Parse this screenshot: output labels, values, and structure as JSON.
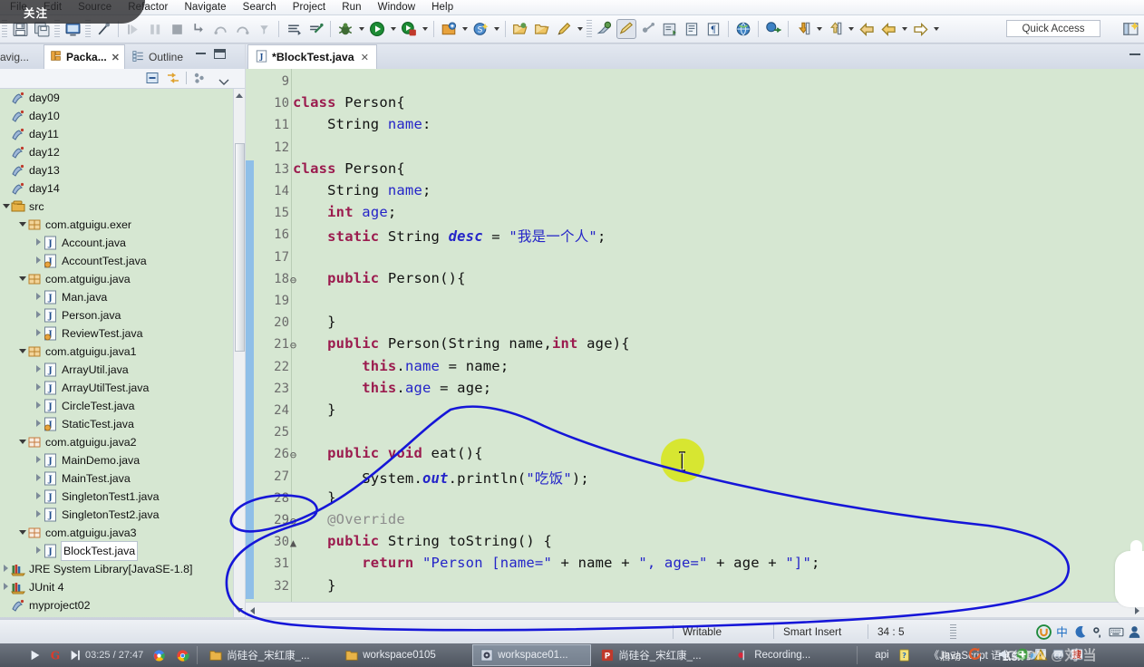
{
  "window": {
    "overlay_badge": "关注"
  },
  "menu": {
    "items": [
      "File",
      "Edit",
      "Source",
      "Refactor",
      "Navigate",
      "Search",
      "Project",
      "Run",
      "Window",
      "Help"
    ]
  },
  "toolbar": {
    "quick_access": "Quick Access",
    "icons": [
      "save-icon",
      "save-all-icon",
      "console-icon",
      "link-icon",
      "run-last-icon",
      "pause-icon",
      "stop-icon",
      "step-into-icon",
      "step-over-icon",
      "step-return-icon",
      "step-filter-icon",
      "skip-breakpoints-icon",
      "debug-toggle-icon",
      "debug-icon",
      "run-icon",
      "coverage-icon",
      "new-java-project-icon",
      "new-scout-icon",
      "open-type-icon",
      "open-task-icon",
      "edit-icon",
      "search-icon",
      "import-icon",
      "export-icon",
      "word-wrap-icon",
      "external-tools-icon",
      "remote-icon",
      "download-icon",
      "upload-icon",
      "back-icon",
      "forward-icon",
      "next-icon"
    ]
  },
  "left_panel": {
    "tabs": [
      {
        "label": "avig...",
        "active": false,
        "closable": false
      },
      {
        "label": "Packa...",
        "active": true,
        "closable": true
      },
      {
        "label": "Outline",
        "active": false,
        "closable": false
      }
    ],
    "view_buttons": [
      "collapse-all-icon",
      "link-with-editor-icon",
      "view-menu-icon",
      "view-dropdown-icon"
    ],
    "tree": [
      {
        "label": "day09",
        "indent": 0,
        "icon": "java-project-icon",
        "twist": "none",
        "selected": false
      },
      {
        "label": "day10",
        "indent": 0,
        "icon": "java-project-icon",
        "twist": "none",
        "selected": false
      },
      {
        "label": "day11",
        "indent": 0,
        "icon": "java-project-icon",
        "twist": "none",
        "selected": false
      },
      {
        "label": "day12",
        "indent": 0,
        "icon": "java-project-icon",
        "twist": "none",
        "selected": false
      },
      {
        "label": "day13",
        "indent": 0,
        "icon": "java-project-icon",
        "twist": "none",
        "selected": false
      },
      {
        "label": "day14",
        "indent": 0,
        "icon": "java-project-icon",
        "twist": "none",
        "selected": false
      },
      {
        "label": "src",
        "indent": 0,
        "icon": "source-folder-icon",
        "twist": "open",
        "selected": false
      },
      {
        "label": "com.atguigu.exer",
        "indent": 1,
        "icon": "package-icon",
        "twist": "open",
        "selected": false
      },
      {
        "label": "Account.java",
        "indent": 2,
        "icon": "java-file-icon",
        "twist": "closed",
        "selected": false
      },
      {
        "label": "AccountTest.java",
        "indent": 2,
        "icon": "java-file-main-icon",
        "twist": "closed",
        "selected": false
      },
      {
        "label": "com.atguigu.java",
        "indent": 1,
        "icon": "package-icon",
        "twist": "open",
        "selected": false
      },
      {
        "label": "Man.java",
        "indent": 2,
        "icon": "java-file-icon",
        "twist": "closed",
        "selected": false
      },
      {
        "label": "Person.java",
        "indent": 2,
        "icon": "java-file-icon",
        "twist": "closed",
        "selected": false
      },
      {
        "label": "ReviewTest.java",
        "indent": 2,
        "icon": "java-file-main-icon",
        "twist": "closed",
        "selected": false
      },
      {
        "label": "com.atguigu.java1",
        "indent": 1,
        "icon": "package-icon",
        "twist": "open",
        "selected": false
      },
      {
        "label": "ArrayUtil.java",
        "indent": 2,
        "icon": "java-file-icon",
        "twist": "closed",
        "selected": false
      },
      {
        "label": "ArrayUtilTest.java",
        "indent": 2,
        "icon": "java-file-icon",
        "twist": "closed",
        "selected": false
      },
      {
        "label": "CircleTest.java",
        "indent": 2,
        "icon": "java-file-icon",
        "twist": "closed",
        "selected": false
      },
      {
        "label": "StaticTest.java",
        "indent": 2,
        "icon": "java-file-main-icon",
        "twist": "closed",
        "selected": false
      },
      {
        "label": "com.atguigu.java2",
        "indent": 1,
        "icon": "package-empty-icon",
        "twist": "open",
        "selected": false
      },
      {
        "label": "MainDemo.java",
        "indent": 2,
        "icon": "java-file-icon",
        "twist": "closed",
        "selected": false
      },
      {
        "label": "MainTest.java",
        "indent": 2,
        "icon": "java-file-icon",
        "twist": "closed",
        "selected": false
      },
      {
        "label": "SingletonTest1.java",
        "indent": 2,
        "icon": "java-file-icon",
        "twist": "closed",
        "selected": false
      },
      {
        "label": "SingletonTest2.java",
        "indent": 2,
        "icon": "java-file-icon",
        "twist": "closed",
        "selected": false
      },
      {
        "label": "com.atguigu.java3",
        "indent": 1,
        "icon": "package-empty-icon",
        "twist": "open",
        "selected": false
      },
      {
        "label": "BlockTest.java",
        "indent": 2,
        "icon": "java-file-icon",
        "twist": "closed",
        "selected": true
      },
      {
        "label": "JRE System Library",
        "suffix": " [JavaSE-1.8]",
        "indent": 0,
        "icon": "library-icon",
        "twist": "closed",
        "selected": false
      },
      {
        "label": "JUnit 4",
        "indent": 0,
        "icon": "library-icon",
        "twist": "closed",
        "selected": false
      },
      {
        "label": "myproject02",
        "indent": 0,
        "icon": "java-project-icon",
        "twist": "none",
        "selected": false
      }
    ]
  },
  "editor": {
    "tab": {
      "label": "*BlockTest.java",
      "icon": "java-file-icon",
      "close": "✕"
    },
    "minimize_icon": "minimize-icon",
    "first_line_number": 9,
    "lines": [
      {
        "n": 9,
        "fold": "",
        "marked": false,
        "tokens": []
      },
      {
        "n": 10,
        "fold": "",
        "marked": false,
        "tokens": [
          {
            "t": "class ",
            "c": "kw"
          },
          {
            "t": "Person{",
            "c": "pl"
          }
        ]
      },
      {
        "n": 11,
        "fold": "",
        "marked": false,
        "tokens": [
          {
            "t": "    String ",
            "c": "pl"
          },
          {
            "t": "name",
            "c": "fld"
          },
          {
            "t": ":",
            "c": "pl"
          }
        ]
      },
      {
        "n": 12,
        "fold": "",
        "marked": false,
        "tokens": []
      },
      {
        "n": 13,
        "fold": "",
        "marked": true,
        "tokens": [
          {
            "t": "class ",
            "c": "kw"
          },
          {
            "t": "Person{",
            "c": "pl"
          }
        ]
      },
      {
        "n": 14,
        "fold": "",
        "marked": true,
        "tokens": [
          {
            "t": "    String ",
            "c": "pl"
          },
          {
            "t": "name",
            "c": "fld"
          },
          {
            "t": ";",
            "c": "pl"
          }
        ]
      },
      {
        "n": 15,
        "fold": "",
        "marked": true,
        "tokens": [
          {
            "t": "    ",
            "c": "pl"
          },
          {
            "t": "int ",
            "c": "kw"
          },
          {
            "t": "age",
            "c": "fld"
          },
          {
            "t": ";",
            "c": "pl"
          }
        ]
      },
      {
        "n": 16,
        "fold": "",
        "marked": true,
        "tokens": [
          {
            "t": "    ",
            "c": "pl"
          },
          {
            "t": "static ",
            "c": "kw"
          },
          {
            "t": "String ",
            "c": "pl"
          },
          {
            "t": "desc",
            "c": "fld-i"
          },
          {
            "t": " = ",
            "c": "pl"
          },
          {
            "t": "\"我是一个人\"",
            "c": "str"
          },
          {
            "t": ";",
            "c": "pl"
          }
        ]
      },
      {
        "n": 17,
        "fold": "",
        "marked": true,
        "tokens": []
      },
      {
        "n": 18,
        "fold": "⊖",
        "marked": true,
        "tokens": [
          {
            "t": "    ",
            "c": "pl"
          },
          {
            "t": "public ",
            "c": "kw"
          },
          {
            "t": "Person(){",
            "c": "pl"
          }
        ]
      },
      {
        "n": 19,
        "fold": "",
        "marked": true,
        "tokens": []
      },
      {
        "n": 20,
        "fold": "",
        "marked": true,
        "tokens": [
          {
            "t": "    }",
            "c": "pl"
          }
        ]
      },
      {
        "n": 21,
        "fold": "⊖",
        "marked": true,
        "tokens": [
          {
            "t": "    ",
            "c": "pl"
          },
          {
            "t": "public ",
            "c": "kw"
          },
          {
            "t": "Person(String name,",
            "c": "pl"
          },
          {
            "t": "int",
            "c": "kw"
          },
          {
            "t": " age){",
            "c": "pl"
          }
        ]
      },
      {
        "n": 22,
        "fold": "",
        "marked": true,
        "tokens": [
          {
            "t": "        ",
            "c": "pl"
          },
          {
            "t": "this",
            "c": "kw"
          },
          {
            "t": ".",
            "c": "pl"
          },
          {
            "t": "name",
            "c": "fld"
          },
          {
            "t": " = name;",
            "c": "pl"
          }
        ]
      },
      {
        "n": 23,
        "fold": "",
        "marked": true,
        "tokens": [
          {
            "t": "        ",
            "c": "pl"
          },
          {
            "t": "this",
            "c": "kw"
          },
          {
            "t": ".",
            "c": "pl"
          },
          {
            "t": "age",
            "c": "fld"
          },
          {
            "t": " = age;",
            "c": "pl"
          }
        ]
      },
      {
        "n": 24,
        "fold": "",
        "marked": true,
        "tokens": [
          {
            "t": "    }",
            "c": "pl"
          }
        ]
      },
      {
        "n": 25,
        "fold": "",
        "marked": true,
        "tokens": []
      },
      {
        "n": 26,
        "fold": "⊖",
        "marked": true,
        "tokens": [
          {
            "t": "    ",
            "c": "pl"
          },
          {
            "t": "public void ",
            "c": "kw"
          },
          {
            "t": "eat(){",
            "c": "pl"
          }
        ]
      },
      {
        "n": 27,
        "fold": "",
        "marked": true,
        "tokens": [
          {
            "t": "        System.",
            "c": "pl"
          },
          {
            "t": "out",
            "c": "fld-i"
          },
          {
            "t": ".println(",
            "c": "pl"
          },
          {
            "t": "\"吃饭\"",
            "c": "str"
          },
          {
            "t": ");",
            "c": "pl"
          }
        ]
      },
      {
        "n": 28,
        "fold": "",
        "marked": true,
        "tokens": [
          {
            "t": "    }",
            "c": "pl"
          }
        ]
      },
      {
        "n": 29,
        "fold": "⊖",
        "marked": true,
        "tokens": [
          {
            "t": "    ",
            "c": "pl"
          },
          {
            "t": "@Override",
            "c": "ann"
          }
        ]
      },
      {
        "n": 30,
        "fold": "▲",
        "marked": true,
        "tokens": [
          {
            "t": "    ",
            "c": "pl"
          },
          {
            "t": "public ",
            "c": "kw"
          },
          {
            "t": "String toString() {",
            "c": "pl"
          }
        ]
      },
      {
        "n": 31,
        "fold": "",
        "marked": true,
        "tokens": [
          {
            "t": "        ",
            "c": "pl"
          },
          {
            "t": "return ",
            "c": "kw"
          },
          {
            "t": "\"Person [name=\"",
            "c": "str"
          },
          {
            "t": " + name + ",
            "c": "pl"
          },
          {
            "t": "\", age=\"",
            "c": "str"
          },
          {
            "t": " + age + ",
            "c": "pl"
          },
          {
            "t": "\"]\"",
            "c": "str"
          },
          {
            "t": ";",
            "c": "pl"
          }
        ]
      },
      {
        "n": 32,
        "fold": "",
        "marked": true,
        "tokens": [
          {
            "t": "    }",
            "c": "pl"
          }
        ]
      }
    ],
    "cursor_icon": "text-ibeam-cursor",
    "annotation": "blue-hand-drawn-loop"
  },
  "status_bar": {
    "writable": "Writable",
    "insert_mode": "Smart Insert",
    "position": "34 : 5",
    "tray_icons": [
      "ime-u-icon",
      "ime-chinese-icon",
      "moon-icon",
      "degree-icon",
      "keyboard-icon",
      "user-icon"
    ]
  },
  "taskbar": {
    "media": {
      "play_icon": "play-icon",
      "next_icon": "next-icon",
      "time": "03:25 / 27:47"
    },
    "apps": [
      {
        "label": "尚硅谷_宋红康_...",
        "icon": "folder-icon",
        "active": false
      },
      {
        "label": "workspace0105",
        "icon": "folder-icon",
        "active": false
      },
      {
        "label": "workspace01...",
        "icon": "eclipse-icon",
        "active": true
      },
      {
        "label": "尚硅谷_宋红康_...",
        "icon": "powerpoint-icon",
        "active": false
      },
      {
        "label": "Recording...",
        "icon": "record-icon",
        "active": false
      },
      {
        "label": "api",
        "icon": "chm-icon",
        "active": false
      },
      {
        "label": "《JavaScript 语言参考...",
        "icon": "",
        "active": false
      }
    ],
    "speed": "1.5x",
    "ime_label": "启动",
    "watermark": "CSDN @刘 当"
  }
}
